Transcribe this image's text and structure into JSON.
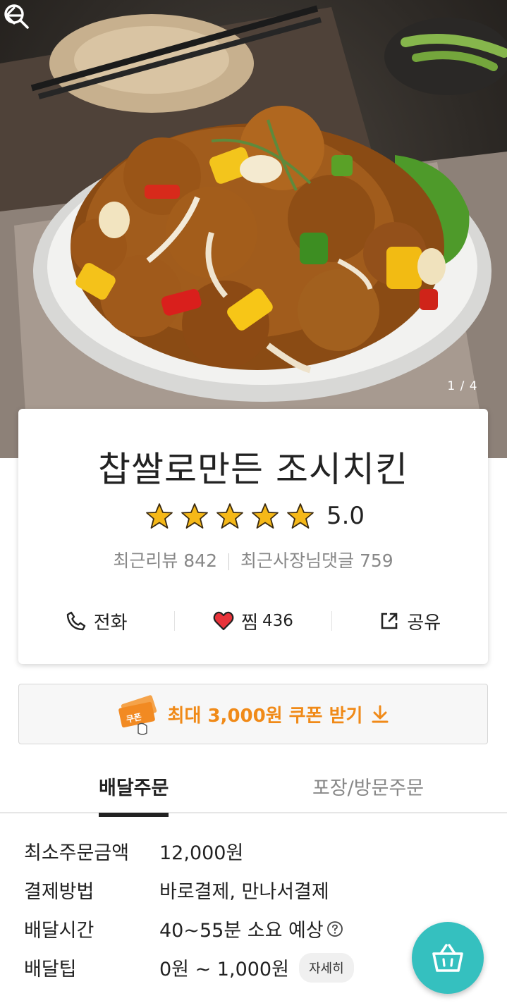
{
  "hero": {
    "image": "sweet-and-sour-chicken-photo",
    "page_current": "1",
    "page_sep": "/",
    "page_total": "4"
  },
  "store": {
    "name": "찹쌀로만든 조시치킨",
    "rating": "5.0",
    "stars": 5,
    "reviews_label": "최근리뷰",
    "reviews_count": "842",
    "replies_label": "최근사장님댓글",
    "replies_count": "759"
  },
  "actions": {
    "call_label": "전화",
    "favorite_label": "찜",
    "favorite_count": "436",
    "share_label": "공유"
  },
  "coupon": {
    "icon_text": "쿠폰",
    "label": "최대 3,000원 쿠폰 받기"
  },
  "tabs": {
    "delivery": "배달주문",
    "pickup": "포장/방문주문",
    "selected": "delivery"
  },
  "info": {
    "min_order_label": "최소주문금액",
    "min_order_value": "12,000원",
    "payment_label": "결제방법",
    "payment_value": "바로결제, 만나서결제",
    "delivery_time_label": "배달시간",
    "delivery_time_value": "40~55분 소요 예상",
    "delivery_tip_label": "배달팁",
    "delivery_tip_value": "0원 ~ 1,000원",
    "detail_button": "자세히"
  },
  "colors": {
    "accent_orange": "#f08a18",
    "cart_teal": "#35c0bf",
    "heart_red": "#e8333a",
    "star_gold": "#f5b818"
  },
  "icons": [
    "back-arrow-icon",
    "search-icon",
    "star-icon",
    "phone-icon",
    "heart-icon",
    "share-icon",
    "coupon-ticket-icon",
    "download-arrow-icon",
    "help-circle-icon",
    "shopping-basket-icon"
  ]
}
